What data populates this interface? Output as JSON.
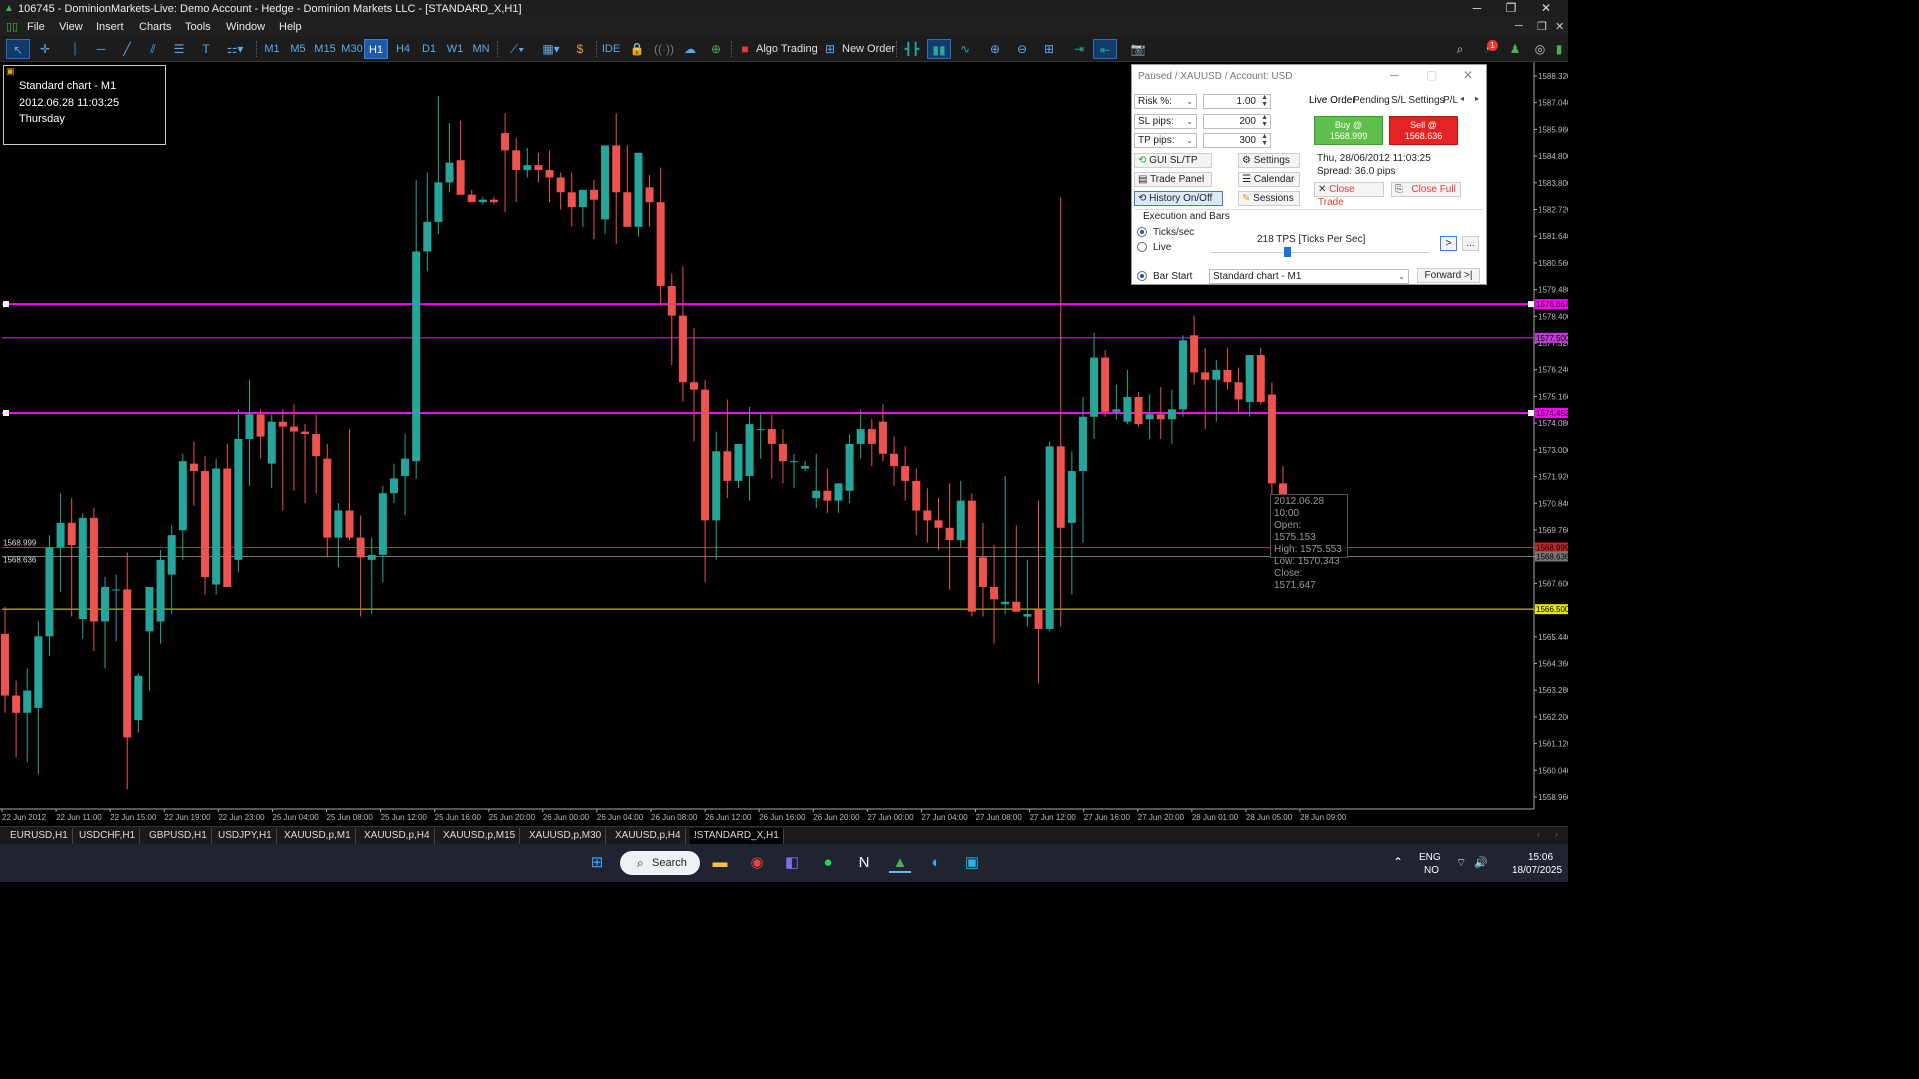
{
  "window": {
    "title": "106745 - DominionMarkets-Live: Demo Account - Hedge - Dominion Markets LLC - [STANDARD_X,H1]"
  },
  "menu": [
    "File",
    "View",
    "Insert",
    "Charts",
    "Tools",
    "Window",
    "Help"
  ],
  "toolbar": {
    "timeframes": [
      "M1",
      "M5",
      "M15",
      "M30",
      "H1",
      "H4",
      "D1",
      "W1",
      "MN"
    ],
    "active_timeframe": "H1",
    "ide_label": "IDE",
    "algo_trading_label": "Algo Trading",
    "new_order_label": "New Order",
    "notification_count": "1"
  },
  "info_box": {
    "line1": "Standard chart - M1",
    "line2": "2012.06.28 11:03:25",
    "line3": "Thursday"
  },
  "colors": {
    "bull": "#26a69a",
    "bear": "#ef5350",
    "magenta_line": "#ff00ff",
    "violet_line": "#c03ad8",
    "yellow_line": "#e8e800",
    "ask_line": "#c62828",
    "bid_line": "#777777",
    "buy_button": "#5ec04a",
    "sell_button": "#e52323"
  },
  "chart_data": {
    "type": "candlestick",
    "symbol": "STANDARD_X",
    "timeframe": "H1",
    "price_axis_labels": [
      "1588.320",
      "1587.040",
      "1585.960",
      "1584.800",
      "1583.800",
      "1582.720",
      "1581.640",
      "1580.560",
      "1579.480",
      "1578.400",
      "1577.320",
      "1576.240",
      "1575.160",
      "1574.080",
      "1573.000",
      "1571.920",
      "1570.840",
      "1569.760",
      "1568.680",
      "1567.600",
      "1566.520",
      "1565.440",
      "1564.360",
      "1563.280",
      "1562.200",
      "1561.120",
      "1560.040",
      "1558.960"
    ],
    "time_axis_labels": [
      "22 Jun 2012",
      "22 Jun 11:00",
      "22 Jun 15:00",
      "22 Jun 19:00",
      "22 Jun 23:00",
      "25 Jun 04:00",
      "25 Jun 08:00",
      "25 Jun 12:00",
      "25 Jun 16:00",
      "25 Jun 20:00",
      "26 Jun 00:00",
      "26 Jun 04:00",
      "26 Jun 08:00",
      "26 Jun 12:00",
      "26 Jun 16:00",
      "26 Jun 20:00",
      "27 Jun 00:00",
      "27 Jun 04:00",
      "27 Jun 08:00",
      "27 Jun 12:00",
      "27 Jun 16:00",
      "27 Jun 20:00",
      "28 Jun 01:00",
      "28 Jun 05:00",
      "28 Jun 09:00"
    ],
    "ylim": [
      1558.4,
      1588.6
    ],
    "candles": [
      [
        1565.5,
        1566.6,
        1562.3,
        1563.0
      ],
      [
        1563.0,
        1563.6,
        1560.5,
        1562.3
      ],
      [
        1562.3,
        1564.1,
        1560.3,
        1563.2
      ],
      [
        1562.5,
        1566.0,
        1559.8,
        1565.4
      ],
      [
        1565.4,
        1569.5,
        1564.6,
        1569.0
      ],
      [
        1569.0,
        1571.2,
        1567.2,
        1570.0
      ],
      [
        1570.0,
        1571.0,
        1566.2,
        1569.1
      ],
      [
        1566.1,
        1570.4,
        1565.3,
        1570.2
      ],
      [
        1570.2,
        1570.6,
        1564.8,
        1566.0
      ],
      [
        1566.0,
        1567.8,
        1564.1,
        1567.4
      ],
      [
        1567.3,
        1567.9,
        1565.2,
        1567.3
      ],
      [
        1567.3,
        1568.8,
        1559.2,
        1561.3
      ],
      [
        1562.0,
        1563.9,
        1561.5,
        1563.8
      ],
      [
        1565.6,
        1567.3,
        1563.2,
        1567.4
      ],
      [
        1566.0,
        1568.9,
        1565.1,
        1568.5
      ],
      [
        1567.9,
        1569.9,
        1566.3,
        1569.5
      ],
      [
        1569.7,
        1572.8,
        1568.5,
        1572.5
      ],
      [
        1572.4,
        1573.3,
        1570.7,
        1572.1
      ],
      [
        1572.1,
        1572.7,
        1567.1,
        1567.8
      ],
      [
        1567.5,
        1572.6,
        1567.1,
        1572.2
      ],
      [
        1572.2,
        1573.2,
        1567.6,
        1567.4
      ],
      [
        1568.5,
        1574.6,
        1568.0,
        1573.4
      ],
      [
        1573.4,
        1575.8,
        1571.5,
        1574.4
      ],
      [
        1574.4,
        1574.6,
        1572.6,
        1573.5
      ],
      [
        1572.4,
        1574.4,
        1571.4,
        1574.1
      ],
      [
        1574.1,
        1574.6,
        1570.5,
        1573.9
      ],
      [
        1573.9,
        1574.8,
        1571.3,
        1573.7
      ],
      [
        1573.7,
        1574.0,
        1570.8,
        1573.6
      ],
      [
        1573.6,
        1574.4,
        1571.2,
        1572.7
      ],
      [
        1572.6,
        1573.2,
        1568.6,
        1569.4
      ],
      [
        1569.4,
        1570.8,
        1568.2,
        1570.5
      ],
      [
        1570.5,
        1573.8,
        1569.3,
        1569.4
      ],
      [
        1569.4,
        1570.3,
        1566.2,
        1568.6
      ],
      [
        1568.5,
        1569.4,
        1566.3,
        1568.7
      ],
      [
        1568.7,
        1571.5,
        1567.6,
        1571.2
      ],
      [
        1571.2,
        1572.4,
        1570.8,
        1571.8
      ],
      [
        1571.9,
        1573.6,
        1570.3,
        1572.6
      ],
      [
        1572.5,
        1583.9,
        1571.8,
        1581.0
      ],
      [
        1581.0,
        1584.2,
        1580.2,
        1582.2
      ],
      [
        1582.2,
        1587.3,
        1581.7,
        1583.8
      ],
      [
        1583.8,
        1586.2,
        1583.4,
        1584.6
      ],
      [
        1584.7,
        1586.3,
        1583.6,
        1583.3
      ],
      [
        1583.3,
        1583.5,
        1583.0,
        1583.0
      ],
      [
        1583.0,
        1583.2,
        1582.9,
        1583.1
      ],
      [
        1583.1,
        1583.2,
        1582.9,
        1583.0
      ],
      [
        1585.8,
        1586.6,
        1582.6,
        1585.1
      ],
      [
        1585.1,
        1585.6,
        1583.0,
        1584.3
      ],
      [
        1584.3,
        1585.2,
        1584.0,
        1584.5
      ],
      [
        1584.5,
        1585.0,
        1583.8,
        1584.3
      ],
      [
        1584.3,
        1585.1,
        1583.0,
        1584.0
      ],
      [
        1584.0,
        1584.2,
        1582.7,
        1583.4
      ],
      [
        1583.4,
        1584.2,
        1582.0,
        1582.8
      ],
      [
        1582.8,
        1583.3,
        1582.0,
        1583.5
      ],
      [
        1583.5,
        1583.9,
        1581.5,
        1583.1
      ],
      [
        1582.3,
        1584.5,
        1581.7,
        1585.3
      ],
      [
        1585.3,
        1586.6,
        1581.3,
        1583.4
      ],
      [
        1583.4,
        1585.3,
        1582.1,
        1582.0
      ],
      [
        1582.0,
        1585.0,
        1581.6,
        1585.0
      ],
      [
        1583.6,
        1584.1,
        1582.0,
        1583.0
      ],
      [
        1583.0,
        1584.4,
        1578.8,
        1579.6
      ],
      [
        1579.6,
        1580.1,
        1576.4,
        1578.4
      ],
      [
        1578.4,
        1580.4,
        1574.9,
        1575.7
      ],
      [
        1575.7,
        1577.9,
        1573.3,
        1575.4
      ],
      [
        1575.4,
        1575.8,
        1567.6,
        1570.1
      ],
      [
        1570.1,
        1573.7,
        1568.5,
        1572.9
      ],
      [
        1572.9,
        1575.0,
        1571.0,
        1571.7
      ],
      [
        1571.7,
        1573.1,
        1571.4,
        1573.2
      ],
      [
        1571.9,
        1574.7,
        1570.9,
        1574.0
      ],
      [
        1573.8,
        1574.5,
        1572.6,
        1573.8
      ],
      [
        1573.8,
        1574.4,
        1571.8,
        1573.2
      ],
      [
        1573.2,
        1573.8,
        1571.6,
        1572.5
      ],
      [
        1572.5,
        1572.8,
        1571.4,
        1572.5
      ],
      [
        1572.2,
        1572.5,
        1572.1,
        1572.3
      ],
      [
        1571.0,
        1572.8,
        1570.6,
        1571.3
      ],
      [
        1571.3,
        1572.2,
        1570.4,
        1570.9
      ],
      [
        1570.9,
        1571.4,
        1570.4,
        1571.6
      ],
      [
        1571.3,
        1573.6,
        1570.8,
        1573.2
      ],
      [
        1573.2,
        1574.6,
        1572.6,
        1573.8
      ],
      [
        1573.8,
        1574.2,
        1572.3,
        1573.2
      ],
      [
        1574.1,
        1574.8,
        1572.5,
        1572.8
      ],
      [
        1572.8,
        1573.5,
        1571.5,
        1572.3
      ],
      [
        1572.3,
        1573.1,
        1570.9,
        1571.7
      ],
      [
        1571.7,
        1572.2,
        1569.5,
        1570.5
      ],
      [
        1570.5,
        1571.4,
        1569.2,
        1570.1
      ],
      [
        1570.1,
        1571.0,
        1568.9,
        1569.8
      ],
      [
        1569.8,
        1571.6,
        1567.3,
        1569.3
      ],
      [
        1569.3,
        1571.7,
        1569.0,
        1570.9
      ],
      [
        1570.9,
        1571.2,
        1566.2,
        1566.4
      ],
      [
        1568.6,
        1570.0,
        1566.2,
        1567.4
      ],
      [
        1567.4,
        1569.1,
        1565.1,
        1566.9
      ],
      [
        1566.7,
        1571.9,
        1566.3,
        1566.8
      ],
      [
        1566.8,
        1569.9,
        1566.7,
        1566.4
      ],
      [
        1566.2,
        1568.5,
        1565.8,
        1566.3
      ],
      [
        1566.5,
        1570.9,
        1563.5,
        1565.7
      ],
      [
        1565.7,
        1573.3,
        1565.6,
        1573.1
      ],
      [
        1573.1,
        1583.2,
        1565.8,
        1569.8
      ],
      [
        1570.0,
        1572.9,
        1567.1,
        1572.1
      ],
      [
        1572.1,
        1575.1,
        1569.2,
        1574.3
      ],
      [
        1574.3,
        1577.7,
        1573.4,
        1576.7
      ],
      [
        1576.7,
        1577.0,
        1574.3,
        1574.5
      ],
      [
        1574.5,
        1575.6,
        1574.2,
        1574.6
      ],
      [
        1574.1,
        1576.2,
        1574.0,
        1575.1
      ],
      [
        1575.1,
        1575.3,
        1573.9,
        1574.0
      ],
      [
        1574.2,
        1575.2,
        1573.4,
        1574.4
      ],
      [
        1574.4,
        1575.5,
        1573.4,
        1574.2
      ],
      [
        1574.2,
        1575.4,
        1573.2,
        1574.6
      ],
      [
        1574.6,
        1577.6,
        1574.3,
        1577.4
      ],
      [
        1577.6,
        1578.4,
        1575.6,
        1576.1
      ],
      [
        1576.1,
        1577.1,
        1573.8,
        1575.8
      ],
      [
        1575.8,
        1576.6,
        1574.1,
        1576.2
      ],
      [
        1576.2,
        1577.1,
        1575.4,
        1575.7
      ],
      [
        1575.7,
        1576.3,
        1574.5,
        1575.0
      ],
      [
        1574.9,
        1576.6,
        1574.3,
        1576.8
      ],
      [
        1576.8,
        1577.1,
        1574.8,
        1574.9
      ],
      [
        1575.2,
        1575.7,
        1570.5,
        1571.6
      ],
      [
        1571.6,
        1572.3,
        1569.5,
        1570.3
      ]
    ],
    "horizontal_levels": [
      {
        "price": 1578.867,
        "color": "#ff00ff",
        "label": "1578.867"
      },
      {
        "price": 1577.5,
        "color": "#c03ad8",
        "label": "1577.500"
      },
      {
        "price": 1574.452,
        "color": "#ff00ff",
        "label": "1574.452"
      },
      {
        "price": 1568.999,
        "color": "#c62828",
        "label": "1568.999"
      },
      {
        "price": 1568.636,
        "color": "#777777",
        "label": "1568.636"
      },
      {
        "price": 1566.5,
        "color": "#e8e800",
        "label": "1566.500"
      }
    ],
    "bid_ask_labels": [
      "1568.999",
      "1568.636"
    ]
  },
  "tooltip": {
    "time": "2012.06.28 10:00",
    "open": "Open: 1575.153",
    "high": "High: 1575.553",
    "low": "Low: 1570.343",
    "close": "Close: 1571.647"
  },
  "panel": {
    "title": "Paused / XAUUSD / Account: USD",
    "risk_label": "Risk %:",
    "risk_value": "1.00",
    "sl_label": "SL pips:",
    "sl_value": "200",
    "tp_label": "TP pips:",
    "tp_value": "300",
    "gui_sltp": "GUI SL/TP",
    "settings": "Settings",
    "trade_panel": "Trade Panel",
    "calendar": "Calendar",
    "history": "History On/Off",
    "sessions": "Sessions",
    "tabs": [
      "Live Order",
      "Pending",
      "S/L Settings",
      "P/L"
    ],
    "buy_line1": "Buy @",
    "buy_line2": "1568.999",
    "sell_line1": "Sell @",
    "sell_line2": "1568.636",
    "datetime": "Thu, 28/06/2012  11:03:25",
    "spread": "Spread: 36.0 pips",
    "close_trade": "Close Trade",
    "close_full": "Close Full",
    "exec_title": "Execution and Bars",
    "ticks_label": "Ticks/sec",
    "live_label": "Live",
    "tps": "218 TPS [Ticks Per Sec]",
    "next_btn": ">",
    "more_btn": "...",
    "bar_start": "Bar Start",
    "chart_select": "Standard chart - M1",
    "forward": "Forward >|"
  },
  "chart_tabs": [
    "EURUSD,H1",
    "USDCHF,H1",
    "GBPUSD,H1",
    "USDJPY,H1",
    "XAUUSD,p,M1",
    "XAUUSD,p,H4",
    "XAUUSD,p,M15",
    "XAUUSD,p,M30",
    "XAUUSD,p,H4",
    "!STANDARD_X,H1"
  ],
  "active_chart_tab": "!STANDARD_X,H1",
  "taskbar": {
    "search": "Search",
    "lang1": "ENG",
    "lang2": "NO",
    "time": "15:06",
    "date": "18/07/2025"
  }
}
